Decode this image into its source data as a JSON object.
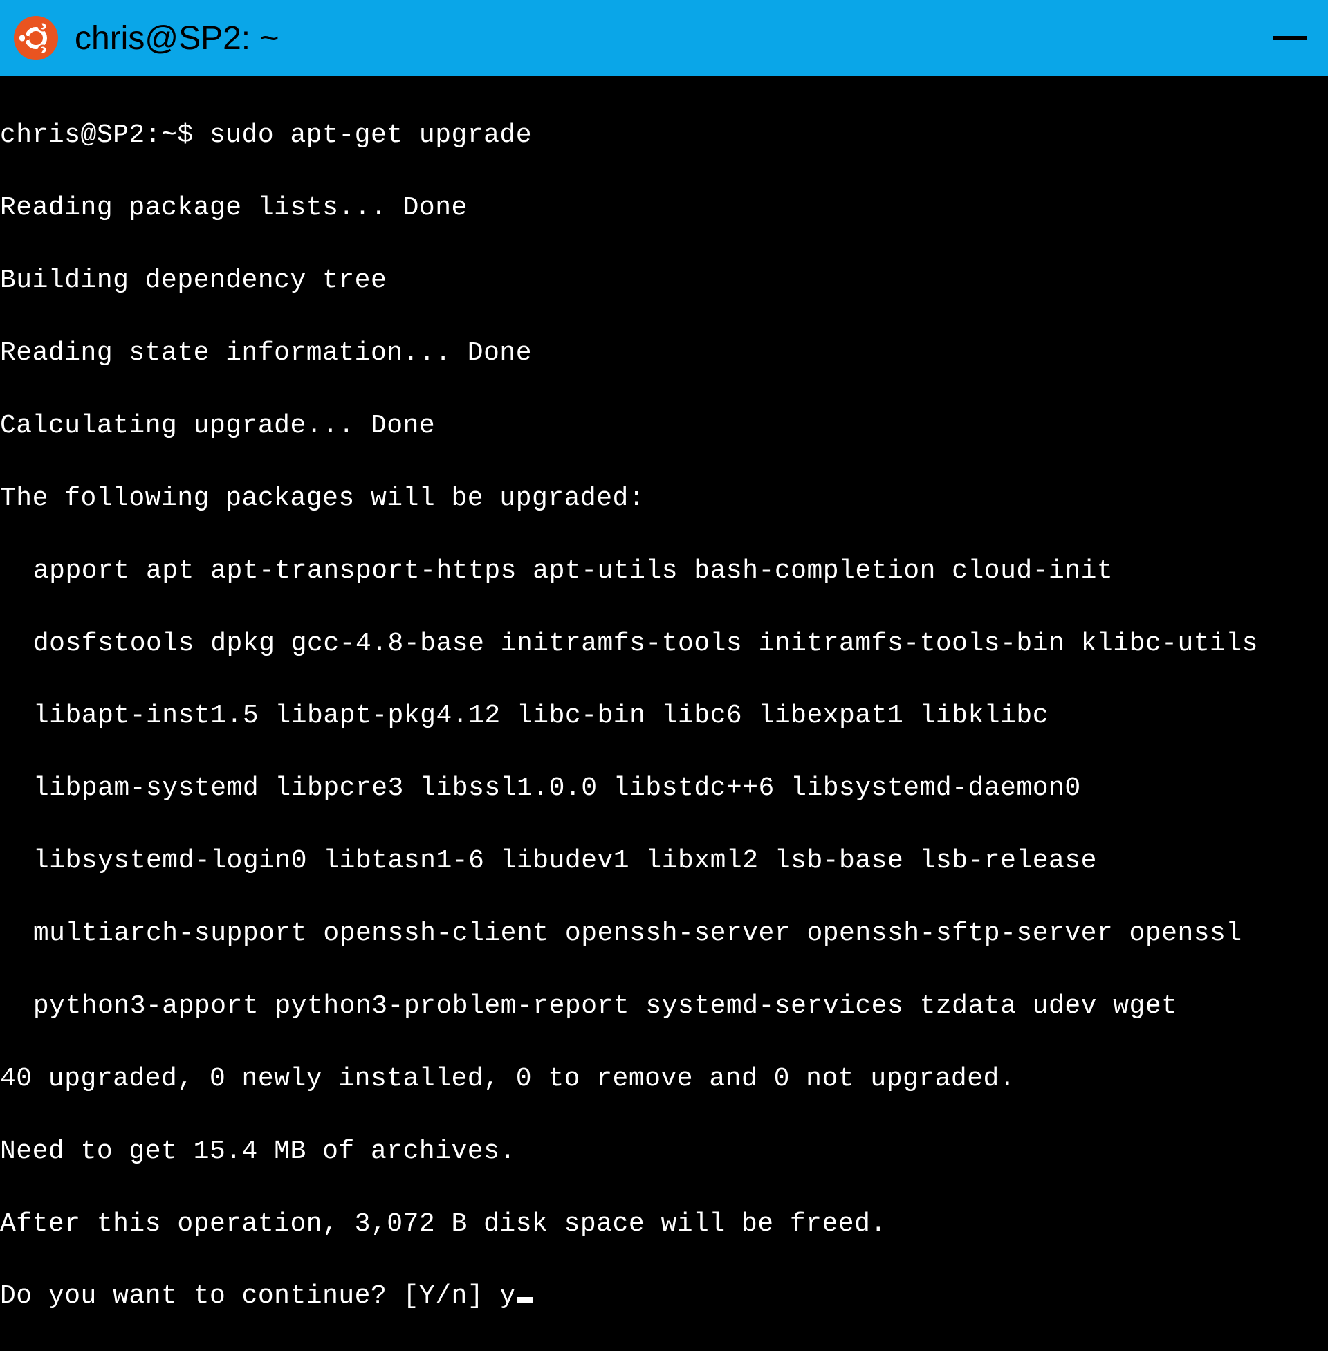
{
  "titlebar": {
    "title": "chris@SP2: ~",
    "icon": "ubuntu-icon",
    "accent_color": "#0aa6e8"
  },
  "terminal": {
    "prompt": "chris@SP2:~$ ",
    "command": "sudo apt-get upgrade",
    "lines": {
      "reading_lists": "Reading package lists... Done",
      "building_tree": "Building dependency tree",
      "reading_state": "Reading state information... Done",
      "calculating": "Calculating upgrade... Done",
      "following_upgraded": "The following packages will be upgraded:",
      "pkg_row1": "apport apt apt-transport-https apt-utils bash-completion cloud-init",
      "pkg_row2": "dosfstools dpkg gcc-4.8-base initramfs-tools initramfs-tools-bin klibc-utils",
      "pkg_row3": "libapt-inst1.5 libapt-pkg4.12 libc-bin libc6 libexpat1 libklibc",
      "pkg_row4": "libpam-systemd libpcre3 libssl1.0.0 libstdc++6 libsystemd-daemon0",
      "pkg_row5": "libsystemd-login0 libtasn1-6 libudev1 libxml2 lsb-base lsb-release",
      "pkg_row6": "multiarch-support openssh-client openssh-server openssh-sftp-server openssl",
      "pkg_row7": "python3-apport python3-problem-report systemd-services tzdata udev wget",
      "summary": "40 upgraded, 0 newly installed, 0 to remove and 0 not upgraded.",
      "need_to_get": "Need to get 15.4 MB of archives.",
      "after_op": "After this operation, 3,072 B disk space will be freed.",
      "continue_prompt": "Do you want to continue? [Y/n] ",
      "user_input": "y"
    }
  }
}
